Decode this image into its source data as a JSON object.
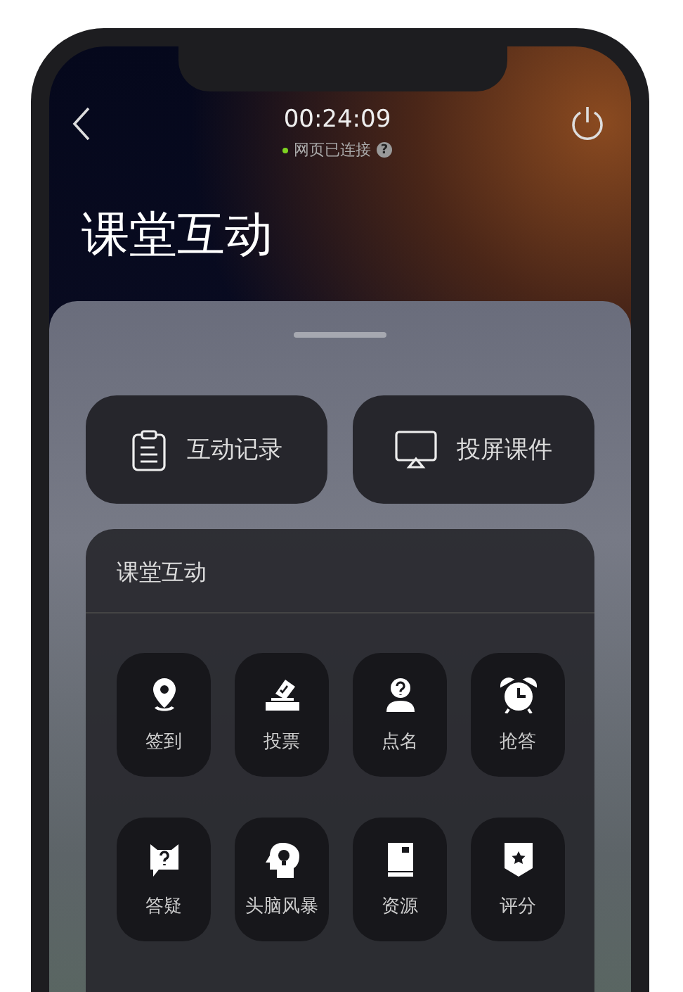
{
  "header": {
    "time": "00:24:09",
    "status": "网页已连接",
    "connected": true,
    "help": "?"
  },
  "title": "课堂互动",
  "actions": [
    {
      "label": "互动记录"
    },
    {
      "label": "投屏课件"
    }
  ],
  "tools_card": {
    "title": "课堂互动",
    "tools": [
      {
        "label": "签到"
      },
      {
        "label": "投票"
      },
      {
        "label": "点名"
      },
      {
        "label": "抢答"
      },
      {
        "label": "答疑"
      },
      {
        "label": "头脑风暴"
      },
      {
        "label": "资源"
      },
      {
        "label": "评分"
      }
    ]
  }
}
